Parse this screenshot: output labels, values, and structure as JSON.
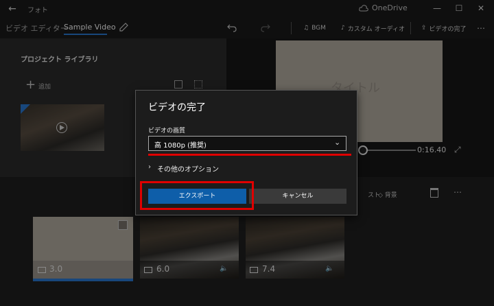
{
  "titlebar": {
    "app_title": "フォト",
    "onedrive": "OneDrive"
  },
  "cmdbar": {
    "breadcrumb_editor": "ビデオ エディター",
    "breadcrumb_sep": "›",
    "breadcrumb_current": "Sample Video",
    "bgm": "BGM",
    "custom_audio": "カスタム オーディオ",
    "finish_video": "ビデオの完了"
  },
  "library": {
    "title": "プロジェクト ライブラリ",
    "add": "追加"
  },
  "preview": {
    "title_text": "タイトル",
    "time": "0:16.40"
  },
  "storyboard": {
    "text_tool": "スト",
    "background_tool": "背景",
    "clips": [
      {
        "duration": "3.0",
        "kind": "title-card"
      },
      {
        "duration": "6.0",
        "kind": "video"
      },
      {
        "duration": "7.4",
        "kind": "video"
      }
    ]
  },
  "dialog": {
    "title": "ビデオの完了",
    "quality_label": "ビデオの画質",
    "quality_value": "高 1080p (推奨)",
    "more_options": "その他のオプション",
    "export_button": "エクスポート",
    "cancel_button": "キャンセル"
  },
  "colors": {
    "accent": "#0e5ea9",
    "highlight": "#e00000"
  },
  "icons": [
    "back-icon",
    "cloud-icon",
    "minimize-icon",
    "maximize-icon",
    "close-icon",
    "pencil-icon",
    "undo-icon",
    "redo-icon",
    "music-icon",
    "audio-icon",
    "share-icon",
    "more-icon",
    "plus-icon",
    "grid-icon",
    "play-icon",
    "expand-icon",
    "trash-icon",
    "image-icon",
    "speaker-icon",
    "chevron-down-icon",
    "chevron-right-icon"
  ]
}
